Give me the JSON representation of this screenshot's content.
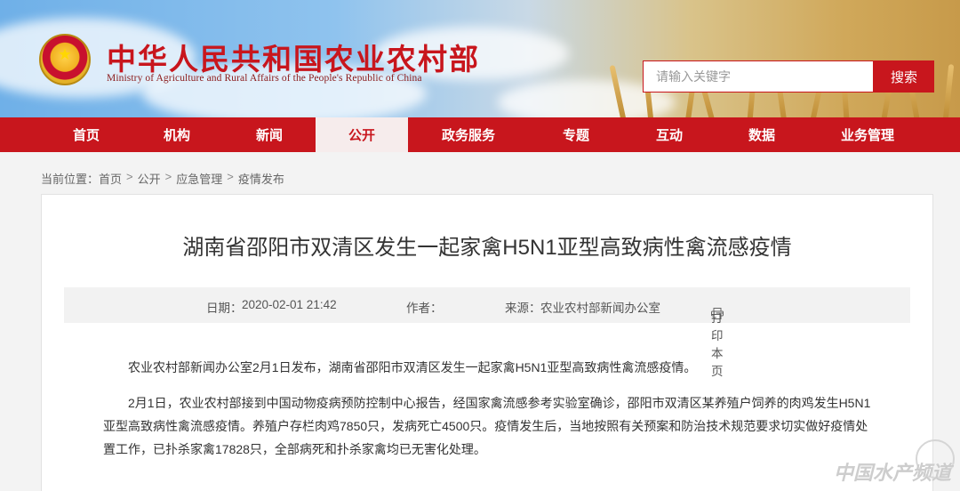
{
  "header": {
    "title": "中华人民共和国农业农村部",
    "subtitle": "Ministry of Agriculture and Rural Affairs of the People's Republic of China",
    "search_placeholder": "请输入关键字",
    "search_button": "搜索"
  },
  "nav": {
    "items": [
      {
        "label": "首页"
      },
      {
        "label": "机构"
      },
      {
        "label": "新闻"
      },
      {
        "label": "公开",
        "active": true
      },
      {
        "label": "政务服务"
      },
      {
        "label": "专题"
      },
      {
        "label": "互动"
      },
      {
        "label": "数据"
      },
      {
        "label": "业务管理"
      }
    ]
  },
  "breadcrumb": {
    "prefix": "当前位置：",
    "items": [
      "首页",
      "公开",
      "应急管理",
      "疫情发布"
    ],
    "separator": ">"
  },
  "article": {
    "title": "湖南省邵阳市双清区发生一起家禽H5N1亚型高致病性禽流感疫情",
    "meta": {
      "date_label": "日期：",
      "date_value": "2020-02-01 21:42",
      "author_label": "作者：",
      "author_value": "",
      "source_label": "来源：",
      "source_value": "农业农村部新闻办公室",
      "print_label": "打印本页"
    },
    "paragraphs": [
      "农业农村部新闻办公室2月1日发布，湖南省邵阳市双清区发生一起家禽H5N1亚型高致病性禽流感疫情。",
      "2月1日，农业农村部接到中国动物疫病预防控制中心报告，经国家禽流感参考实验室确诊，邵阳市双清区某养殖户饲养的肉鸡发生H5N1亚型高致病性禽流感疫情。养殖户存栏肉鸡7850只，发病死亡4500只。疫情发生后，当地按照有关预案和防治技术规范要求切实做好疫情处置工作，已扑杀家禽17828只，全部病死和扑杀家禽均已无害化处理。"
    ]
  },
  "watermark": "中国水产频道",
  "colors": {
    "brand_red": "#c8161d",
    "nav_active_bg": "#f6ecec"
  }
}
